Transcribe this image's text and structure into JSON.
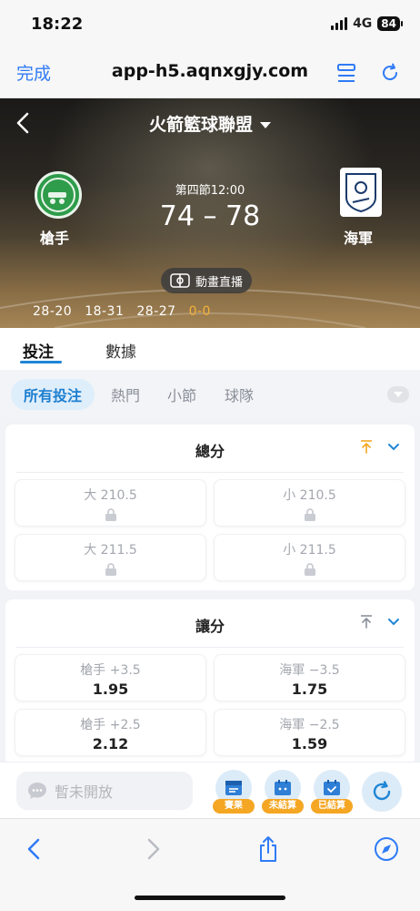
{
  "status_bar": {
    "time": "18:22",
    "network": "4G",
    "battery": "84"
  },
  "browser": {
    "done_label": "完成",
    "url": "app-h5.aqnxgjy.com"
  },
  "match": {
    "league": "火箭籃球聯盟",
    "home_team": "槍手",
    "away_team": "海軍",
    "period": "第四節12:00",
    "score": "74 – 78",
    "live_label": "動畫直播",
    "quarters": [
      "28-20",
      "18-31",
      "28-27"
    ],
    "current_quarter": "0-0"
  },
  "main_tabs": [
    {
      "label": "投注",
      "active": true
    },
    {
      "label": "數據",
      "active": false
    }
  ],
  "filter_tabs": [
    {
      "label": "所有投注",
      "active": true
    },
    {
      "label": "熱門",
      "active": false
    },
    {
      "label": "小節",
      "active": false
    },
    {
      "label": "球隊",
      "active": false
    }
  ],
  "markets": [
    {
      "title": "總分",
      "pin_color": "#f5a623",
      "rows": [
        [
          {
            "label": "大 210.5",
            "locked": true
          },
          {
            "label": "小 210.5",
            "locked": true
          }
        ],
        [
          {
            "label": "大 211.5",
            "locked": true
          },
          {
            "label": "小 211.5",
            "locked": true
          }
        ]
      ]
    },
    {
      "title": "讓分",
      "pin_color": "#8a8f99",
      "rows": [
        [
          {
            "label": "槍手 +3.5",
            "odds": "1.95"
          },
          {
            "label": "海軍 −3.5",
            "odds": "1.75"
          }
        ],
        [
          {
            "label": "槍手 +2.5",
            "odds": "2.12"
          },
          {
            "label": "海軍 −2.5",
            "odds": "1.59"
          }
        ]
      ]
    }
  ],
  "bet_bar": {
    "placeholder": "暫未開放",
    "buttons": [
      {
        "label": "賽果"
      },
      {
        "label": "未結算"
      },
      {
        "label": "已結算"
      }
    ]
  },
  "colors": {
    "accent": "#1e86d6",
    "orange": "#f5a623",
    "header_bg": "#2a2722"
  }
}
